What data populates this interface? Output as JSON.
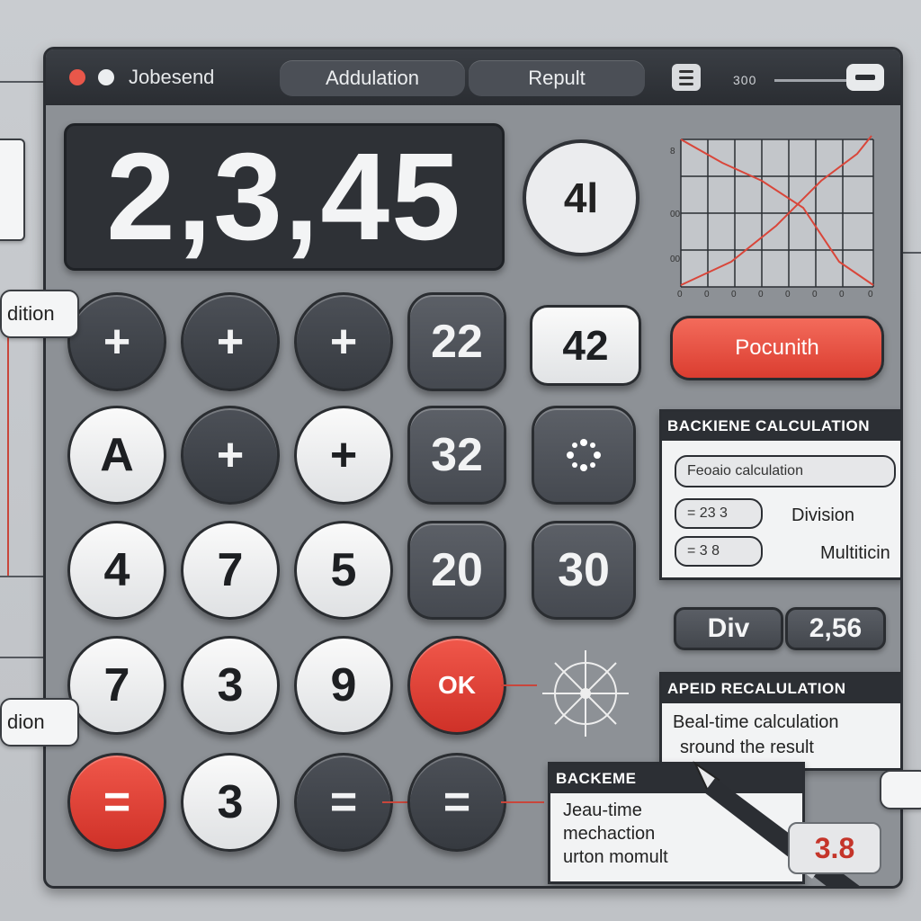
{
  "window": {
    "title": "Jobesend",
    "tabs": [
      "Addulation",
      "Repult"
    ],
    "slider_value": "300"
  },
  "display": {
    "value": "2,3,45"
  },
  "memory_key": "4l",
  "keypad": {
    "rows": [
      [
        "+",
        "+",
        "+",
        "22",
        "42"
      ],
      [
        "A",
        "+",
        "+",
        "32",
        ""
      ],
      [
        "4",
        "7",
        "5",
        "20",
        "30"
      ],
      [
        "7",
        "3",
        "9",
        "OK",
        ""
      ],
      [
        "=",
        "3",
        "=",
        "=",
        ""
      ]
    ]
  },
  "result_button": "Pocunith",
  "chart": {
    "y_ticks": [
      "8",
      "00",
      "00"
    ],
    "x_ticks": [
      "0",
      "0",
      "0",
      "0",
      "0",
      "0",
      "0",
      "0"
    ]
  },
  "calc_panel": {
    "header": "BACKIENE CALCULATION",
    "field_1": "Feoaio calculation",
    "field_2_value": "= 23 3",
    "field_2_label": "Division",
    "field_3_value": "= 3 8",
    "field_3_label": "Multiticin"
  },
  "div_chip": "Div",
  "value_chip": "2,56",
  "apeid_panel": {
    "header": "APEID RECALULATION",
    "line_1": "Beal-time calculation",
    "line_2": "sround the result"
  },
  "backeme_panel": {
    "header": "BACKEME",
    "line_1": "Jeau-time",
    "line_2": "mechaction",
    "line_3": "urton momult"
  },
  "side_tags": [
    "dition",
    "dion"
  ],
  "result_badge": "3.8",
  "colors": {
    "accent_red": "#db3d30",
    "dark": "#2c2f34",
    "panel_bg": "#8d9196"
  }
}
